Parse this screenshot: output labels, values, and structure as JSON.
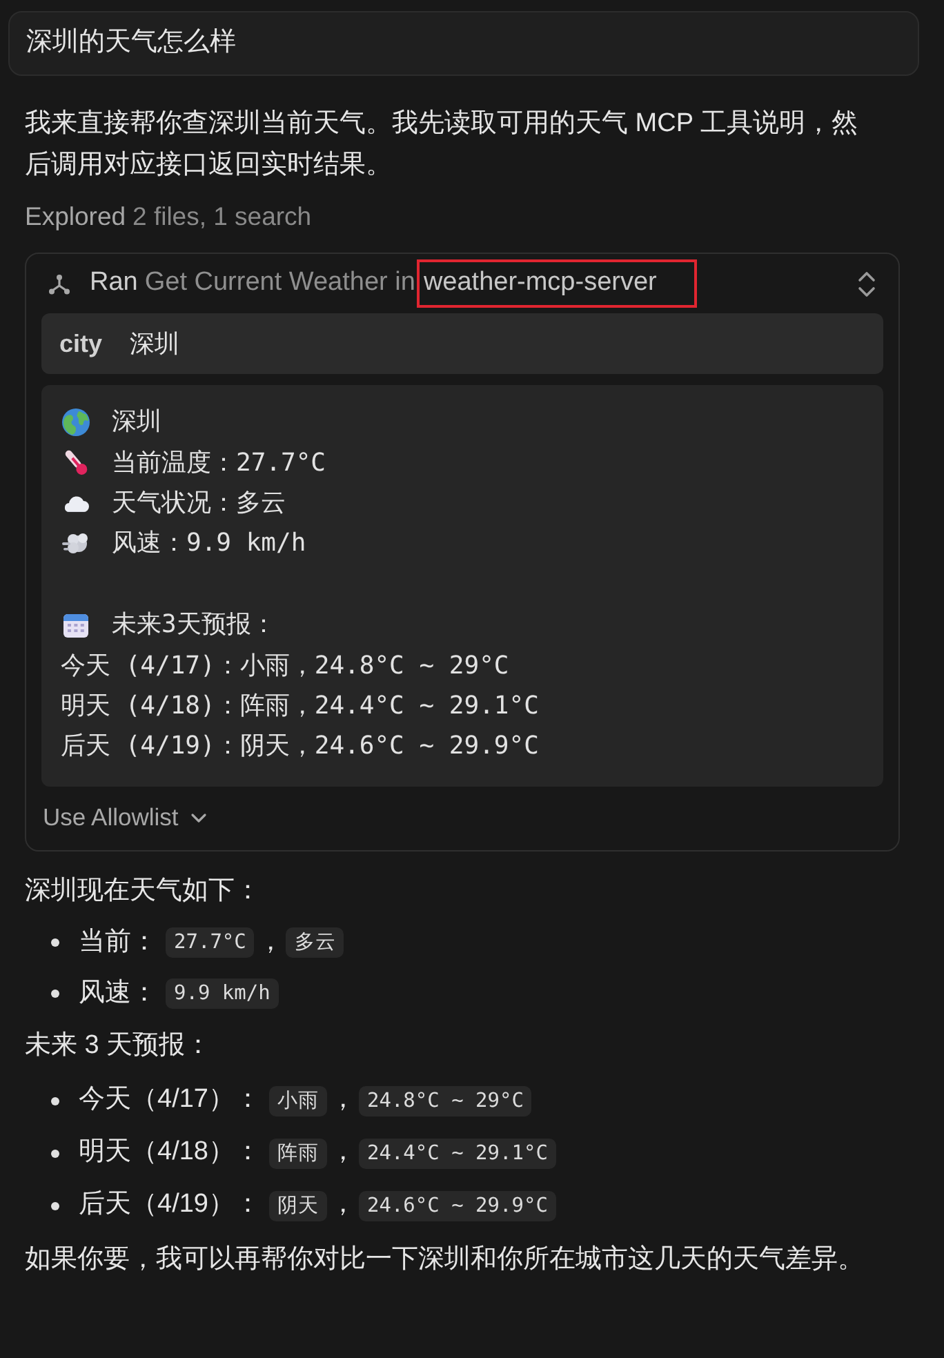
{
  "user_message": {
    "text": "深圳的天气怎么样"
  },
  "assistant_intro": "我来直接帮你查深圳当前天气。我先读取可用的天气 MCP 工具说明，然后调用对应接口返回实时结果。",
  "explored": {
    "label": "Explored",
    "detail": "2 files, 1 search"
  },
  "tool_call": {
    "status": "Ran",
    "description": "Get Current Weather in",
    "server": "weather-mcp-server",
    "server_highlighted": true,
    "arguments": [
      {
        "name": "city",
        "value": "深圳"
      }
    ],
    "result_lines": [
      {
        "kind": "location",
        "text": "深圳"
      },
      {
        "kind": "temperature",
        "text": "当前温度：27.7°C"
      },
      {
        "kind": "condition",
        "text": "天气状况：多云"
      },
      {
        "kind": "wind",
        "text": "风速：9.9 km/h"
      },
      {
        "kind": "blank"
      },
      {
        "kind": "calendar",
        "text": "未来3天预报："
      },
      {
        "kind": "plain",
        "text": "今天 (4/17)：小雨，24.8°C ~ 29°C"
      },
      {
        "kind": "plain",
        "text": "明天 (4/18)：阵雨，24.4°C ~ 29.1°C"
      },
      {
        "kind": "plain",
        "text": "后天 (4/19)：阴天，24.6°C ~ 29.9°C"
      }
    ],
    "footer_button": "Use Allowlist"
  },
  "answer": {
    "sections": [
      {
        "heading": "深圳现在天气如下：",
        "items": [
          {
            "label": "当前：",
            "parts": [
              {
                "kind": "code",
                "text": "27.7°C"
              },
              {
                "kind": "text",
                "text": "，"
              },
              {
                "kind": "code",
                "text": "多云"
              }
            ]
          },
          {
            "label": "风速：",
            "parts": [
              {
                "kind": "code",
                "text": "9.9 km/h"
              }
            ]
          }
        ]
      },
      {
        "heading": "未来 3 天预报：",
        "items": [
          {
            "label": "今天（4/17）：",
            "parts": [
              {
                "kind": "code",
                "text": "小雨"
              },
              {
                "kind": "text",
                "text": "，"
              },
              {
                "kind": "code",
                "text": "24.8°C ~ 29°C"
              }
            ]
          },
          {
            "label": "明天（4/18）：",
            "parts": [
              {
                "kind": "code",
                "text": "阵雨"
              },
              {
                "kind": "text",
                "text": "，"
              },
              {
                "kind": "code",
                "text": "24.4°C ~ 29.1°C"
              }
            ]
          },
          {
            "label": "后天（4/19）：",
            "parts": [
              {
                "kind": "code",
                "text": "阴天"
              },
              {
                "kind": "text",
                "text": "，"
              },
              {
                "kind": "code",
                "text": "24.6°C ~ 29.9°C"
              }
            ]
          }
        ]
      }
    ],
    "closing": "如果你要，我可以再帮你对比一下深圳和你所在城市这几天的天气差异。"
  }
}
